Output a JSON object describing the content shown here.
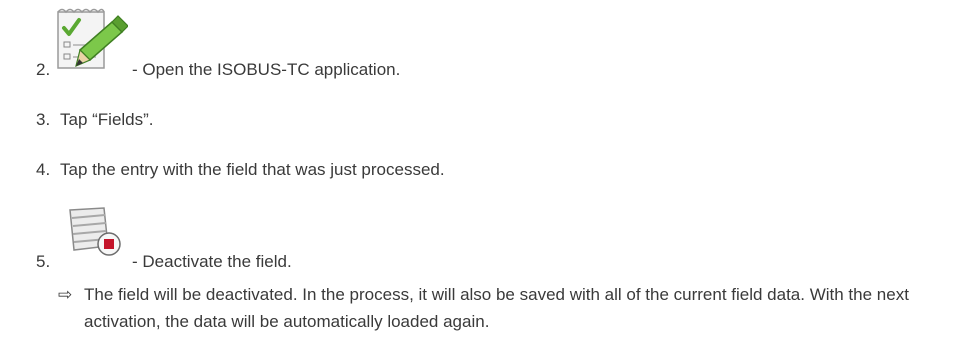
{
  "steps": [
    {
      "number": "2.",
      "icon": "checklist-pencil-icon",
      "text": "- Open the ISOBUS-TC application."
    },
    {
      "number": "3.",
      "text": "Tap “Fields”."
    },
    {
      "number": "4.",
      "text": "Tap the entry with the field that was just processed."
    },
    {
      "number": "5.",
      "icon": "field-deactivate-icon",
      "text": "- Deactivate the field."
    }
  ],
  "result": {
    "arrow": "⇨",
    "text": "The field will be deactivated. In the process, it will also be saved with all of the current field data. With the next activation, the data will be automatically loaded again."
  }
}
